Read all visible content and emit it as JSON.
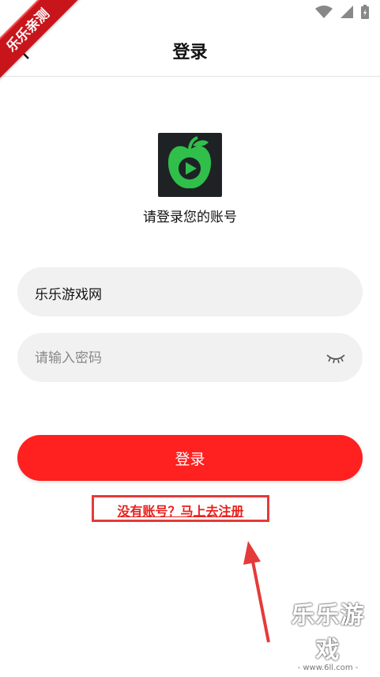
{
  "ribbon": {
    "text": "乐乐亲测"
  },
  "header": {
    "title": "登录"
  },
  "logo": {
    "caption": "请登录您的账号"
  },
  "form": {
    "username_value": "乐乐游戏网",
    "password_placeholder": "请输入密码",
    "login_label": "登录"
  },
  "register": {
    "label": "没有账号？马上去注册"
  },
  "watermark": {
    "title": "乐乐游戏",
    "url": "- www.6ll.com -"
  },
  "colors": {
    "accent": "#ff2020",
    "link": "#e8201c",
    "ribbon": "#c8151c"
  }
}
